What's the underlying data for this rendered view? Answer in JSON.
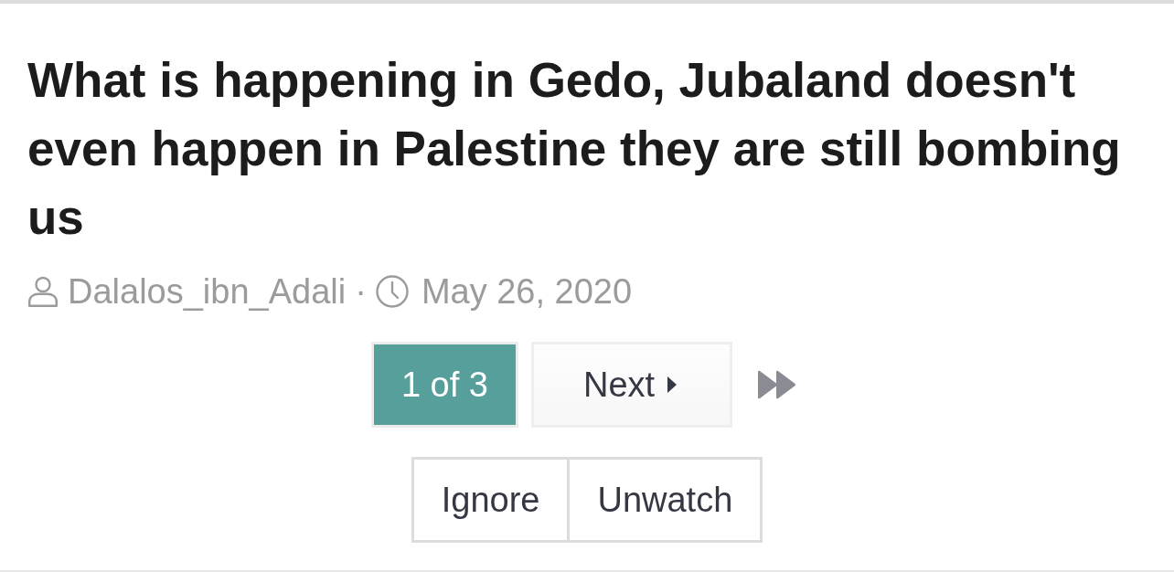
{
  "thread": {
    "title": "What is happening in Gedo, Jubaland doesn't even happen in Palestine they are still bombing us"
  },
  "meta": {
    "author": "Dalalos_ibn_Adali",
    "separator": "·",
    "date": "May 26, 2020"
  },
  "pagination": {
    "page_label": "1 of 3",
    "next_label": "Next"
  },
  "actions": [
    {
      "label": "Ignore"
    },
    {
      "label": "Unwatch"
    }
  ]
}
